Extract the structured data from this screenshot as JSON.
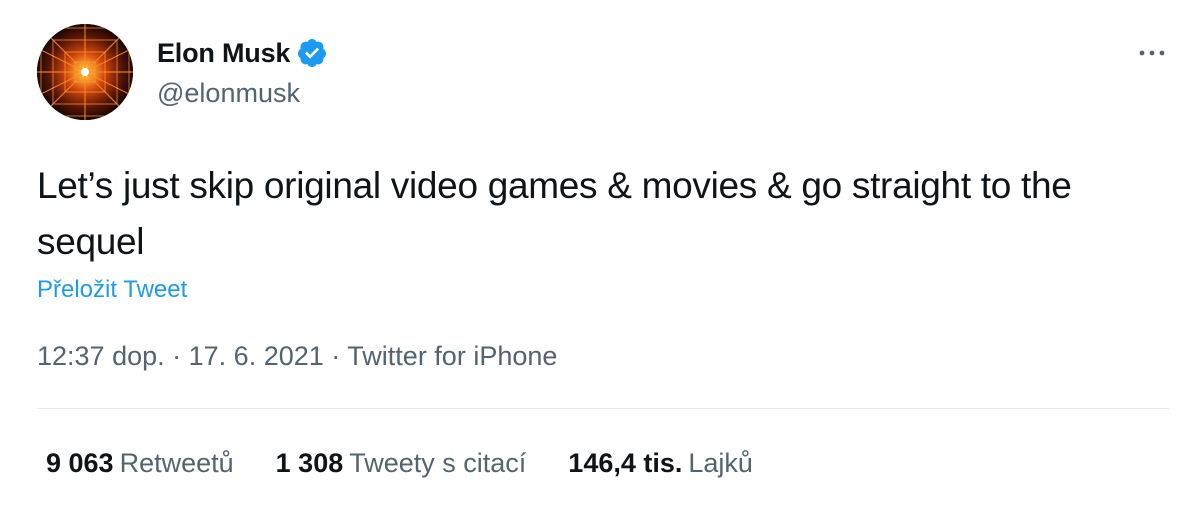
{
  "author": {
    "display_name": "Elon Musk",
    "handle": "@elonmusk",
    "verified": true
  },
  "tweet": {
    "text": "Let’s just skip original video games & movies & go straight to the sequel",
    "translate_label": "Přeložit Tweet",
    "time": "12:37 dop.",
    "separator": "·",
    "date": "17. 6. 2021",
    "source": "Twitter for iPhone"
  },
  "stats": {
    "retweets": {
      "count": "9 063",
      "label": "Retweetů"
    },
    "quotes": {
      "count": "1 308",
      "label": "Tweety s citací"
    },
    "likes": {
      "count": "146,4 tis.",
      "label": "Lajků"
    }
  },
  "icons": {
    "verified": "verified-badge-icon",
    "more": "more-horizontal-icon"
  },
  "colors": {
    "accent": "#1d9bf0",
    "text": "#0f1419",
    "secondary": "#536471"
  }
}
